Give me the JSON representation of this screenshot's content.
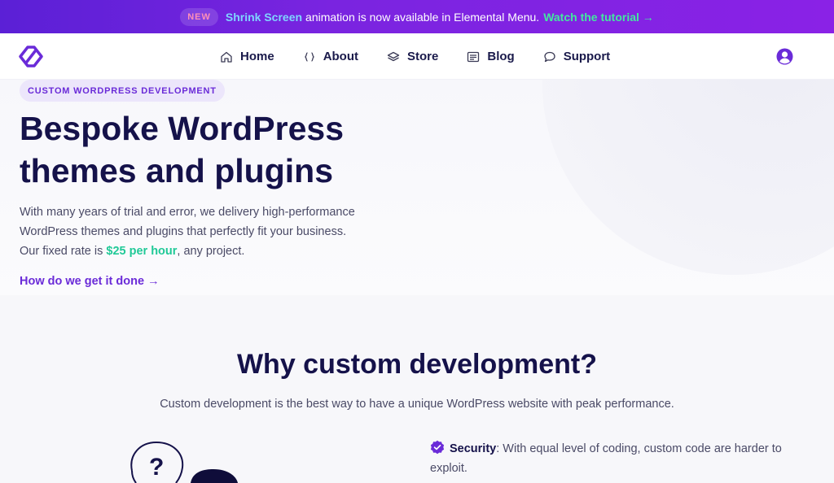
{
  "announcement": {
    "badge": "NEW",
    "feature": "Shrink Screen",
    "message": "animation is now available in Elemental Menu.",
    "link": "Watch the tutorial →"
  },
  "nav": {
    "items": [
      {
        "label": "Home",
        "icon": "home-icon"
      },
      {
        "label": "About",
        "icon": "code-braces-icon"
      },
      {
        "label": "Store",
        "icon": "layers-icon"
      },
      {
        "label": "Blog",
        "icon": "document-icon"
      },
      {
        "label": "Support",
        "icon": "chat-bubble-icon"
      }
    ]
  },
  "hero": {
    "pill": "CUSTOM WORDPRESS DEVELOPMENT",
    "title": "Bespoke WordPress themes and plugins",
    "desc_line1": "With many years of trial and error, we delivery high-performance",
    "desc_line2": "WordPress themes and plugins that perfectly fit your business.",
    "desc_rate_prefix": "Our fixed rate is ",
    "desc_rate": "$25 per hour",
    "desc_rate_suffix": ", any project.",
    "link": "How do we get it done →"
  },
  "why": {
    "title": "Why custom development?",
    "subtitle": "Custom development is the best way to have a unique WordPress website with peak performance.",
    "features": [
      {
        "title": "Security",
        "text": ": With equal level of coding, custom code are harder to exploit."
      }
    ]
  },
  "colors": {
    "brand": "#6a2bd8",
    "accent_green": "#20c997",
    "heading": "#15124a"
  }
}
